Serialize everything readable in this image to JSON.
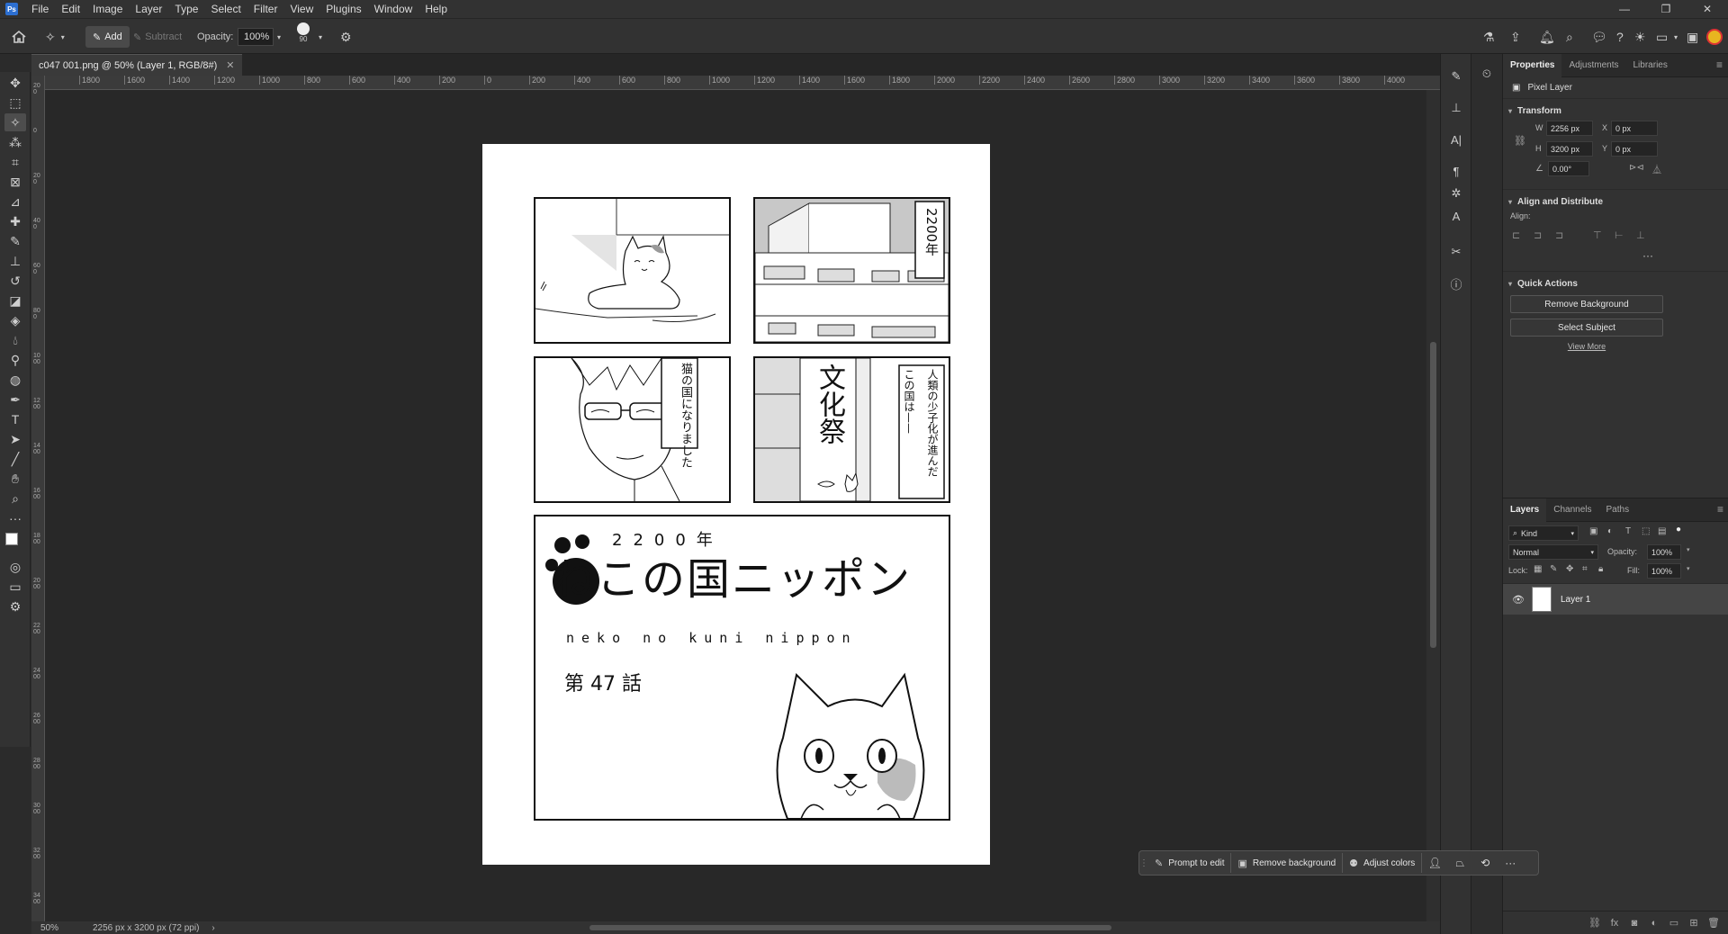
{
  "menubar": {
    "logo": "Ps",
    "items": [
      "File",
      "Edit",
      "Image",
      "Layer",
      "Type",
      "Select",
      "Filter",
      "View",
      "Plugins",
      "Window",
      "Help"
    ]
  },
  "options": {
    "add_label": "Add",
    "subtract_label": "Subtract",
    "opacity_label": "Opacity:",
    "opacity_value": "100%",
    "brush_size": "90"
  },
  "document": {
    "tab_title": "c047 001.png @ 50% (Layer 1, RGB/8#)",
    "zoom": "50%",
    "dimensions": "2256 px x 3200 px (72 ppi)"
  },
  "ruler": {
    "h_ticks": [
      "1800",
      "1600",
      "1400",
      "1200",
      "1000",
      "800",
      "600",
      "400",
      "200",
      "0",
      "200",
      "400",
      "600",
      "800",
      "1000",
      "1200",
      "1400",
      "1600",
      "1800",
      "2000",
      "2200",
      "2400",
      "2600",
      "2800",
      "3000",
      "3200",
      "3400",
      "3600",
      "3800",
      "4000"
    ],
    "v_ticks": [
      "200",
      "0",
      "200",
      "400",
      "600",
      "800",
      "1000",
      "1200",
      "1400",
      "1600",
      "1800",
      "2000",
      "2200",
      "2400",
      "2600",
      "2800",
      "3000",
      "3200",
      "3400",
      "3600"
    ]
  },
  "manga": {
    "panel2_caption": "2200年",
    "panel3_caption": "猫の国になりました",
    "panel4_banner": "文化祭",
    "panel4_caption1": "人類の少子化が進んだ",
    "panel4_caption2": "この国は——",
    "title_year": "2200年",
    "title_main": "ねこの国ニッポン",
    "title_romaji": "neko no kuni nippon",
    "chapter": "第 47 話"
  },
  "properties": {
    "tabs": [
      "Properties",
      "Adjustments",
      "Libraries"
    ],
    "layer_type": "Pixel Layer",
    "transform_title": "Transform",
    "w_label": "W",
    "w_value": "2256 px",
    "h_label": "H",
    "h_value": "3200 px",
    "x_label": "X",
    "x_value": "0 px",
    "y_label": "Y",
    "y_value": "0 px",
    "angle_value": "0.00°",
    "align_title": "Align and Distribute",
    "align_label": "Align:",
    "quick_actions_title": "Quick Actions",
    "remove_bg_button": "Remove Background",
    "select_subject_button": "Select Subject",
    "view_more": "View More"
  },
  "layers": {
    "tabs": [
      "Layers",
      "Channels",
      "Paths"
    ],
    "kind_label": "Kind",
    "blend_mode": "Normal",
    "opacity_label": "Opacity:",
    "opacity_value": "100%",
    "lock_label": "Lock:",
    "fill_label": "Fill:",
    "fill_value": "100%",
    "layer_name": "Layer 1"
  },
  "taskbar": {
    "prompt_label": "Prompt to edit",
    "remove_bg_label": "Remove background",
    "adjust_colors_label": "Adjust colors"
  },
  "colors": {
    "accent": "#2c6fd1",
    "ui_bg": "#323232",
    "canvas_bg": "#282828"
  }
}
